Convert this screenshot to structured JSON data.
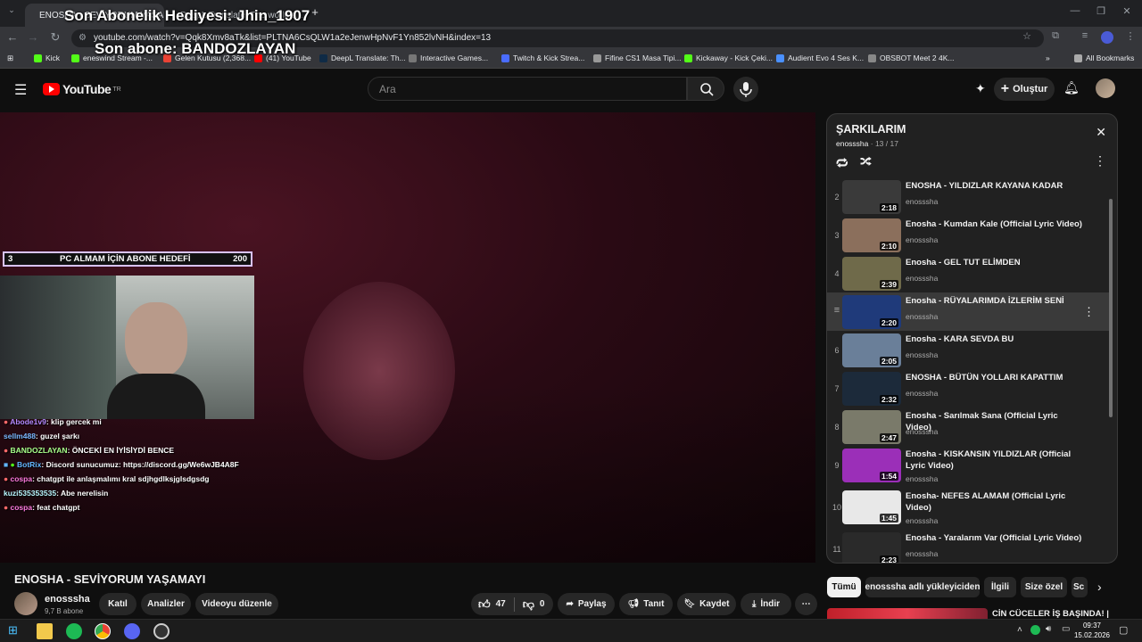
{
  "browser": {
    "tabs": [
      {
        "label": "ENOSHA - SEVİYORUM YAŞAM..."
      },
      {
        "label": "DeepL Translate: The world's..."
      }
    ],
    "url": "youtube.com/watch?v=Qqk8Xmv8aTk&list=PLTNA6CsQLW1a2eJenwHpNvF1Yn852lvNH&index=13",
    "bookmarks": [
      "Kick",
      "eneswind Stream -...",
      "Gelen Kutusu (2,368...",
      "(41) YouTube",
      "DeepL Translate: Th...",
      "Interactive Games...",
      "Twitch & Kick Strea...",
      "Fifine CS1 Masa Tipi...",
      "Kickaway - Kick Çeki...",
      "Audient Evo 4 Ses K...",
      "OBSBOT Meet 2 4K..."
    ],
    "all_bookmarks": "All Bookmarks"
  },
  "stream_overlay": {
    "last_gift": "Son Abonelik Hediyesi: Jhin_1907",
    "last_sub": "Son abone: BANDOZLAYAN",
    "goal": {
      "current": "3",
      "label": "PC ALMAM İÇİN ABONE HEDEFİ",
      "target": "200"
    },
    "chat": [
      {
        "user": "Abode1v9",
        "msg": ": klip gercek mi",
        "color": "#b38aff"
      },
      {
        "user": "sellm488",
        "msg": ": guzel şarkı",
        "color": "#7ab8ff"
      },
      {
        "user": "BANDOZLAYAN",
        "msg": ": ÖNCEKİ EN İYİSİYDİ BENCE",
        "color": "#a7ff8a"
      },
      {
        "user": "BotRix",
        "msg": ": Discord sunucumuz: https://discord.gg/We6wJB4A8F",
        "color": "#63b6ff"
      },
      {
        "user": "cospa",
        "msg": ": chatgpt ile anlaşmalımı kral sdjhgdlksjglsdgsdg",
        "color": "#ff7ae0"
      },
      {
        "user": "kuzi535353535",
        "msg": ": Abe nerelisin",
        "color": "#b9f7ff"
      },
      {
        "user": "cospa",
        "msg": ": feat chatgpt",
        "color": "#ff7ae0"
      }
    ]
  },
  "youtube": {
    "logo": "YouTube",
    "logo_sup": "TR",
    "search_placeholder": "Ara",
    "create_label": "Oluştur",
    "video_title": "ENOSHA - SEVİYORUM YAŞAMAYI",
    "channel": {
      "name": "enosssha",
      "subs": "9,7 B abone"
    },
    "buttons": {
      "join": "Katıl",
      "analytics": "Analizler",
      "edit": "Videoyu düzenle"
    },
    "actions": {
      "likes": "47",
      "dislikes": "0",
      "share": "Paylaş",
      "promote": "Tanıt",
      "save": "Kaydet",
      "download": "İndir"
    }
  },
  "playlist": {
    "title": "ŞARKILARIM",
    "owner": "enosssha",
    "position": "13 / 17",
    "items": [
      {
        "index": "2",
        "title": "ENOSHA - YILDIZLAR KAYANA KADAR",
        "channel": "enosssha",
        "duration": "2:18",
        "bg": "#3a3a3a"
      },
      {
        "index": "3",
        "title": "Enosha - Kumdan Kale (Official Lyric Video)",
        "channel": "enosssha",
        "duration": "2:10",
        "bg": "#8b6f5c"
      },
      {
        "index": "4",
        "title": "Enosha - GEL TUT ELİMDEN",
        "channel": "enosssha",
        "duration": "2:39",
        "bg": "#6f6a4a"
      },
      {
        "index": "",
        "title": "Enosha - RÜYALARIMDA İZLERİM SENİ",
        "channel": "enosssha",
        "duration": "2:20",
        "bg": "#1f3a7a"
      },
      {
        "index": "6",
        "title": "Enosha - KARA SEVDA BU",
        "channel": "enosssha",
        "duration": "2:05",
        "bg": "#6a7f99"
      },
      {
        "index": "7",
        "title": "ENOSHA - BÜTÜN YOLLARI KAPATTIM",
        "channel": "enosssha",
        "duration": "2:32",
        "bg": "#1c2a3a"
      },
      {
        "index": "8",
        "title": "Enosha - Sarılmak Sana (Official Lyric Video)",
        "channel": "enosssha",
        "duration": "2:47",
        "bg": "#7a7a6a"
      },
      {
        "index": "9",
        "title": "Enosha - KISKANSIN YILDIZLAR (Official Lyric Video)",
        "channel": "enosssha",
        "duration": "1:54",
        "bg": "#9b2fb8"
      },
      {
        "index": "10",
        "title": "Enosha- NEFES ALAMAM (Official Lyric Video)",
        "channel": "enosssha",
        "duration": "1:45",
        "bg": "#e8e8e8"
      },
      {
        "index": "11",
        "title": "Enosha - Yaralarım Var (Official Lyric Video)",
        "channel": "enosssha",
        "duration": "2:23",
        "bg": "#2a2a2a"
      }
    ]
  },
  "chips": [
    "Tümü",
    "enosssha adlı yükleyiciden",
    "İlgili",
    "Size özel",
    "Sc"
  ],
  "next_video": "CİN CÜCELER İŞ BAŞINDA! |",
  "taskbar": {
    "time": "09:37",
    "date": "15.02.2026"
  }
}
